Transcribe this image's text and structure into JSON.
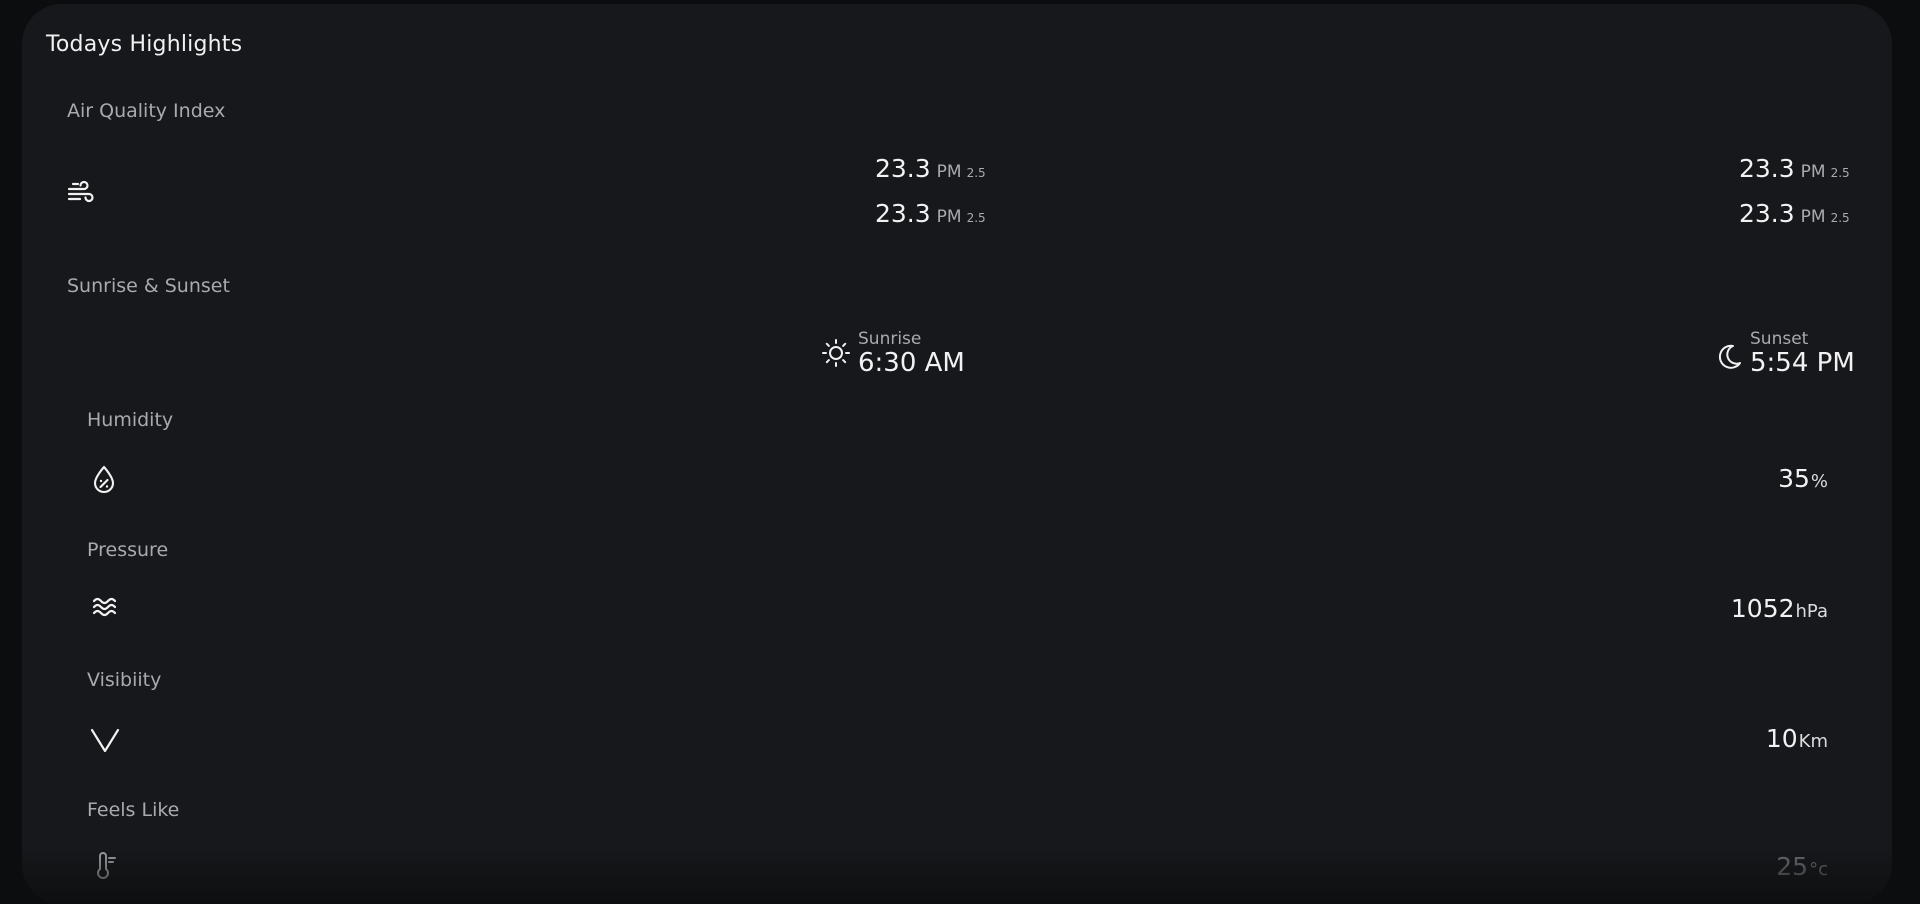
{
  "title": "Todays Highlights",
  "aqi": {
    "label": "Air Quality Index",
    "icon": "wind-icon",
    "readings": [
      {
        "value": "23.3",
        "unit": "PM",
        "sub": "2.5"
      },
      {
        "value": "23.3",
        "unit": "PM",
        "sub": "2.5"
      },
      {
        "value": "23.3",
        "unit": "PM",
        "sub": "2.5"
      },
      {
        "value": "23.3",
        "unit": "PM",
        "sub": "2.5"
      }
    ]
  },
  "sun": {
    "label": "Sunrise & Sunset",
    "sunrise": {
      "label": "Sunrise",
      "time": "6:30 AM",
      "icon": "sun-icon"
    },
    "sunset": {
      "label": "Sunset",
      "time": "5:54 PM",
      "icon": "moon-icon"
    }
  },
  "humidity": {
    "label": "Humidity",
    "value": "35",
    "unit": "%",
    "icon": "humidity-drop-icon"
  },
  "pressure": {
    "label": "Pressure",
    "value": "1052",
    "unit": "hPa",
    "icon": "waves-icon"
  },
  "visibility": {
    "label": "Visibiity",
    "value": "10",
    "unit": "Km",
    "icon": "chevron-down-icon"
  },
  "feels_like": {
    "label": "Feels Like",
    "value": "25",
    "unit": "°c",
    "icon": "thermometer-icon"
  }
}
